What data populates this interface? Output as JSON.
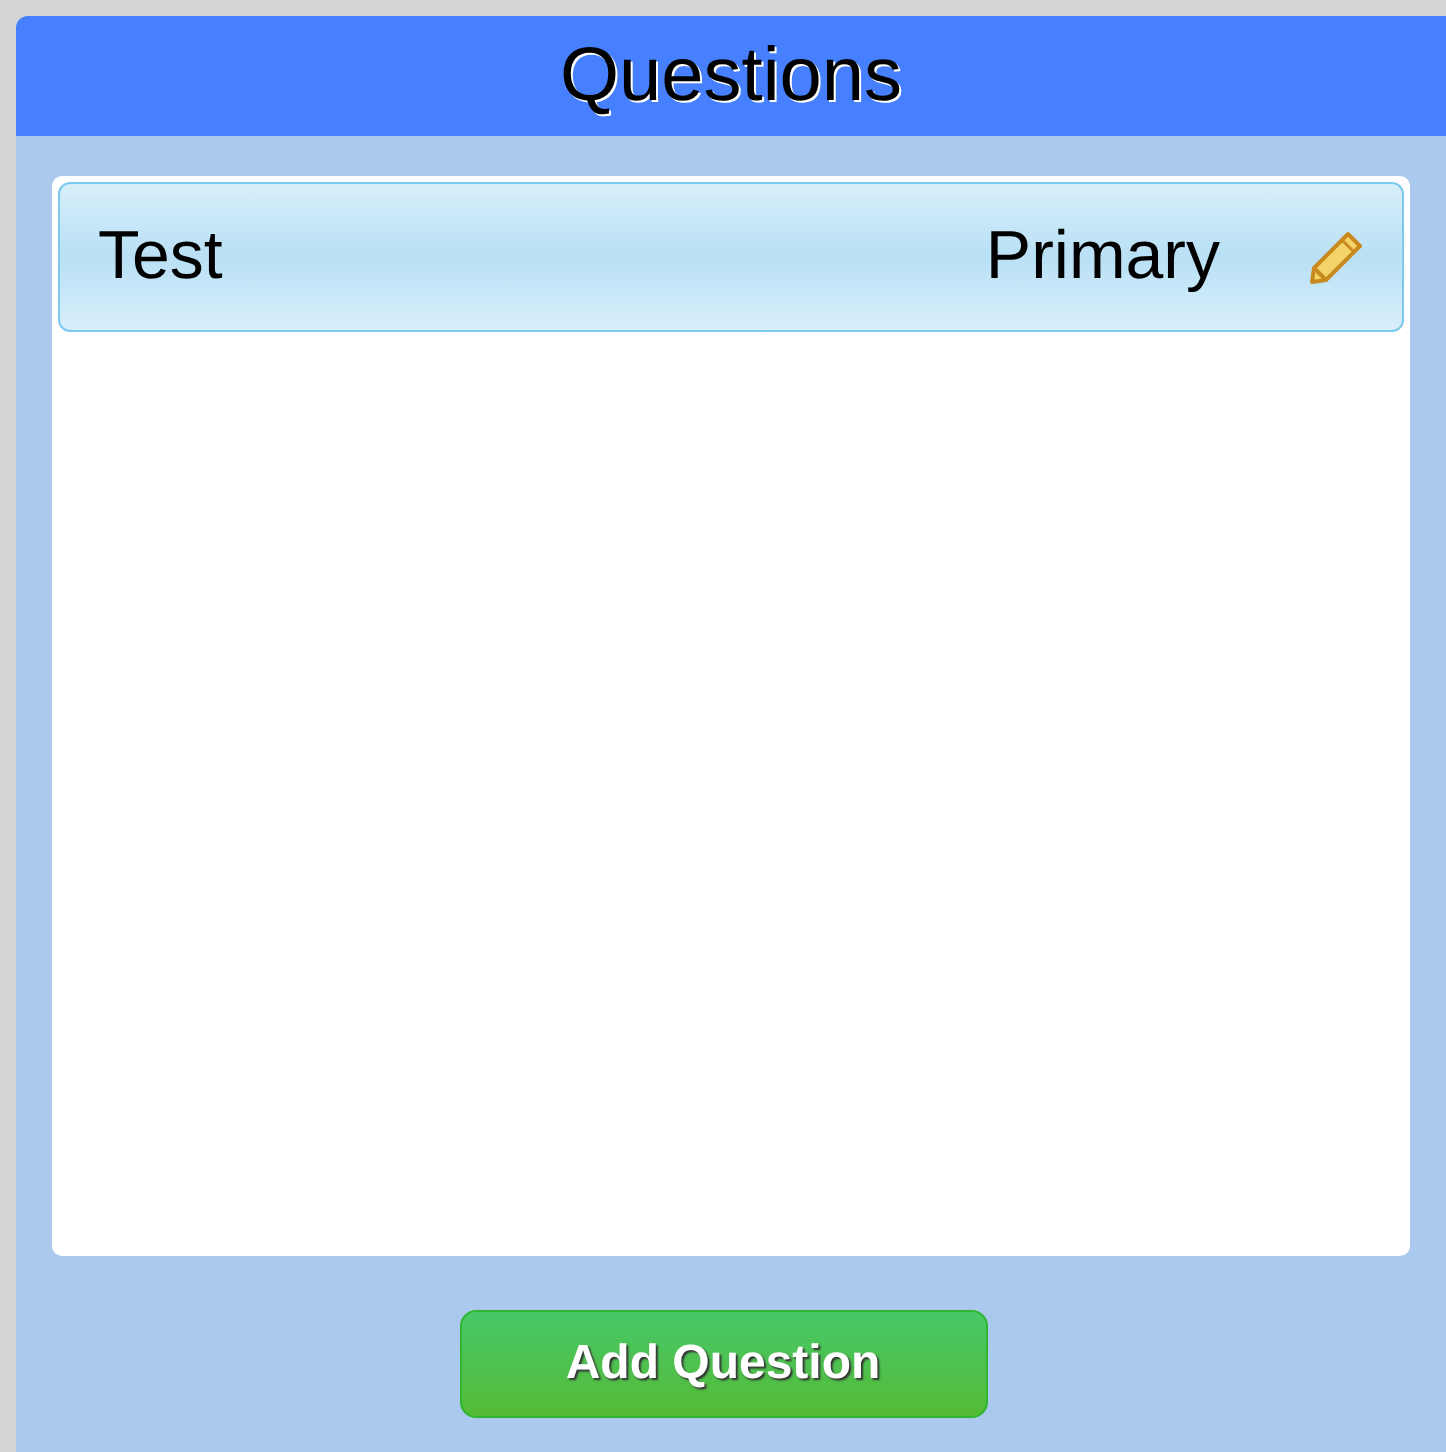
{
  "panel": {
    "title": "Questions"
  },
  "questions": [
    {
      "name": "Test",
      "type": "Primary",
      "selected": true
    }
  ],
  "add_button": {
    "label": "Add Question"
  }
}
